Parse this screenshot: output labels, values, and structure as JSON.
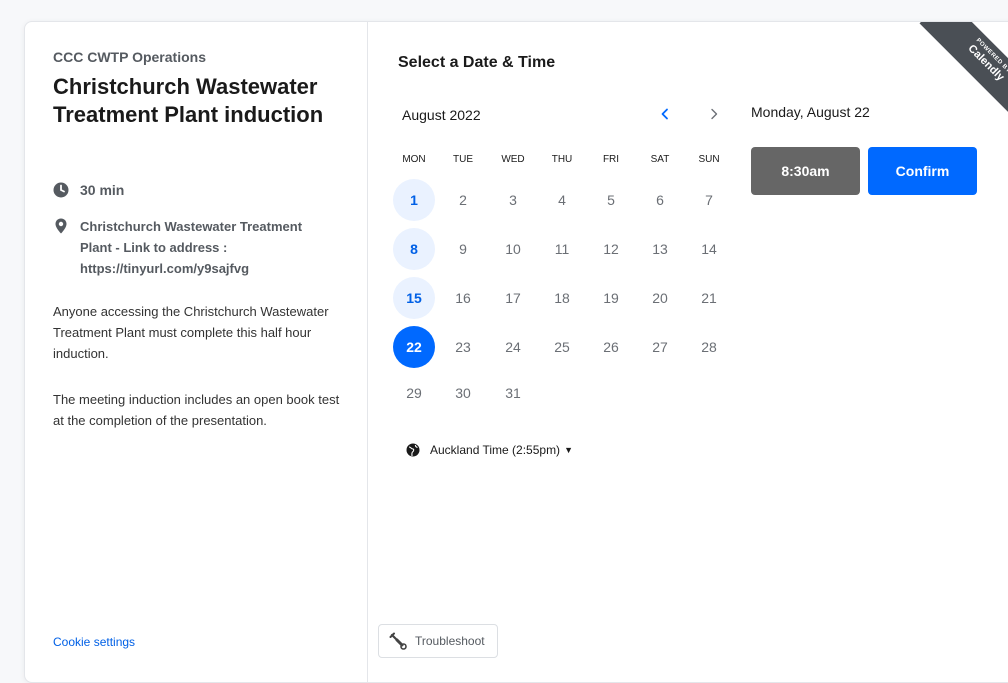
{
  "event": {
    "organization": "CCC CWTP Operations",
    "title": "Christchurch Wastewater Treatment Plant induction",
    "duration": "30 min",
    "location": "Christchurch Wastewater Treatment Plant - Link to address : https://tinyurl.com/y9sajfvg",
    "description_1": "Anyone accessing the Christchurch Wastewater Treatment Plant must complete this half hour induction.",
    "description_2": "The meeting induction includes an open book test at the completion of the presentation.",
    "cookie_settings": "Cookie settings"
  },
  "calendar": {
    "heading": "Select a Date & Time",
    "month_label": "August 2022",
    "prev_icon": "chevron-left-icon",
    "next_icon": "chevron-right-icon",
    "weekdays": [
      "MON",
      "TUE",
      "WED",
      "THU",
      "FRI",
      "SAT",
      "SUN"
    ],
    "weeks": [
      [
        "1",
        "2",
        "3",
        "4",
        "5",
        "6",
        "7"
      ],
      [
        "8",
        "9",
        "10",
        "11",
        "12",
        "13",
        "14"
      ],
      [
        "15",
        "16",
        "17",
        "18",
        "19",
        "20",
        "21"
      ],
      [
        "22",
        "23",
        "24",
        "25",
        "26",
        "27",
        "28"
      ],
      [
        "29",
        "30",
        "31"
      ]
    ],
    "available_days": [
      "1",
      "8",
      "15"
    ],
    "selected_day": "22",
    "timezone_label": "Auckland Time (2:55pm)"
  },
  "times": {
    "selected_date_label": "Monday, August 22",
    "selected_time": "8:30am",
    "confirm_label": "Confirm"
  },
  "badge": {
    "powered_by": "POWERED BY",
    "brand": "Calendly"
  },
  "troubleshoot_label": "Troubleshoot",
  "colors": {
    "accent": "#0069ff",
    "available_bg": "#eaf2ff",
    "time_button": "#666666",
    "ribbon": "#4a4f55"
  }
}
